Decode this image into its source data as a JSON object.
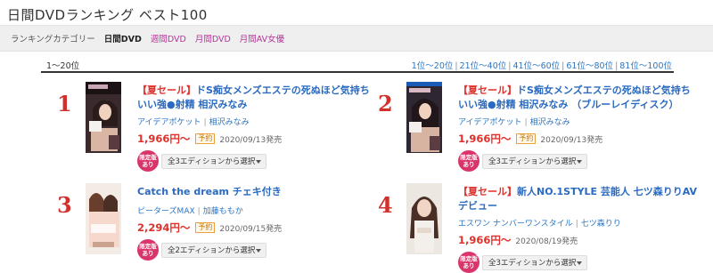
{
  "header": {
    "title": "日間DVDランキング ベスト100"
  },
  "category": {
    "label": "ランキングカテゴリー",
    "items": [
      "日間DVD",
      "週間DVD",
      "月間DVD",
      "月間AV女優"
    ]
  },
  "range": {
    "current": "1〜20位",
    "pages": [
      "1位〜20位",
      "21位〜40位",
      "41位〜60位",
      "61位〜80位",
      "81位〜100位"
    ]
  },
  "items": [
    {
      "rank": "1",
      "sale": "【夏セール】",
      "title": "ドS痴女メンズエステの死ぬほど気持ちいい強●射精 相沢みなみ",
      "maker": "アイデアポケット",
      "actress": "相沢みなみ",
      "price": "1,966円〜",
      "badge": "予約",
      "date": "2020/09/13発売",
      "limited": "限定版あり",
      "select": "全3エディションから選択"
    },
    {
      "rank": "2",
      "sale": "【夏セール】",
      "title": "ドS痴女メンズエステの死ぬほど気持ちいい強●射精 相沢みなみ （ブルーレイディスク）",
      "maker": "アイデアポケット",
      "actress": "相沢みなみ",
      "price": "1,966円〜",
      "badge": "予約",
      "date": "2020/09/13発売",
      "limited": "限定版あり",
      "select": "全3エディションから選択"
    },
    {
      "rank": "3",
      "sale": "",
      "title": "Catch the dream チェキ付き",
      "maker": "ピーターズMAX",
      "actress": "加藤ももか",
      "price": "2,294円〜",
      "badge": "予約",
      "date": "2020/09/15発売",
      "limited": "限定版あり",
      "select": "全2エディションから選択"
    },
    {
      "rank": "4",
      "sale": "【夏セール】",
      "title": "新人NO.1STYLE 芸能人 七ツ森りりAVデビュー",
      "maker": "エスワン ナンバーワンスタイル",
      "actress": "七ツ森りり",
      "price": "1,966円〜",
      "badge": "",
      "date": "2020/08/19発売",
      "limited": "限定版あり",
      "select": "全3エディションから選択"
    }
  ]
}
